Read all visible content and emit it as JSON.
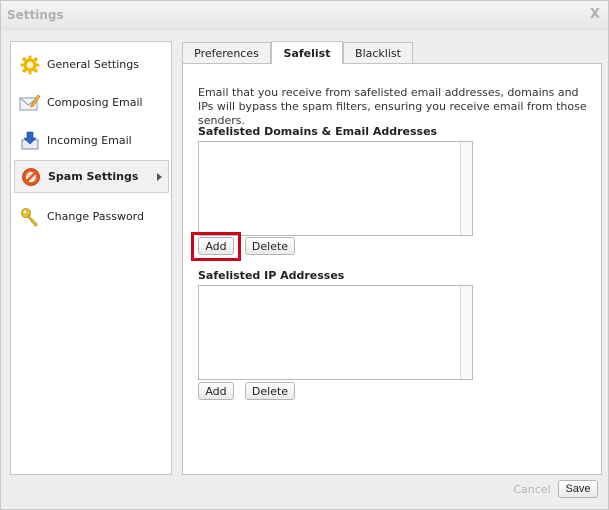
{
  "window": {
    "title": "Settings",
    "close_glyph": "X"
  },
  "sidebar": {
    "items": [
      {
        "label": "General Settings",
        "icon": "gear-icon",
        "selected": false
      },
      {
        "label": "Composing Email",
        "icon": "compose-icon",
        "selected": false
      },
      {
        "label": "Incoming Email",
        "icon": "inbox-download-icon",
        "selected": false
      },
      {
        "label": "Spam Settings",
        "icon": "prohibited-icon",
        "selected": true
      },
      {
        "label": "Change Password",
        "icon": "key-icon",
        "selected": false
      }
    ]
  },
  "tabs": [
    {
      "label": "Preferences",
      "active": false
    },
    {
      "label": "Safelist",
      "active": true
    },
    {
      "label": "Blacklist",
      "active": false
    }
  ],
  "safelist": {
    "description": "Email that you receive from safelisted email addresses, domains and IPs will bypass the spam filters, ensuring you receive email from those senders.",
    "domains_label": "Safelisted Domains & Email Addresses",
    "ips_label": "Safelisted IP Addresses",
    "add_label": "Add",
    "delete_label": "Delete"
  },
  "footer": {
    "cancel_label": "Cancel",
    "save_label": "Save"
  },
  "colors": {
    "highlight": "#d0021b",
    "disabled_text": "#b5b5b5"
  }
}
